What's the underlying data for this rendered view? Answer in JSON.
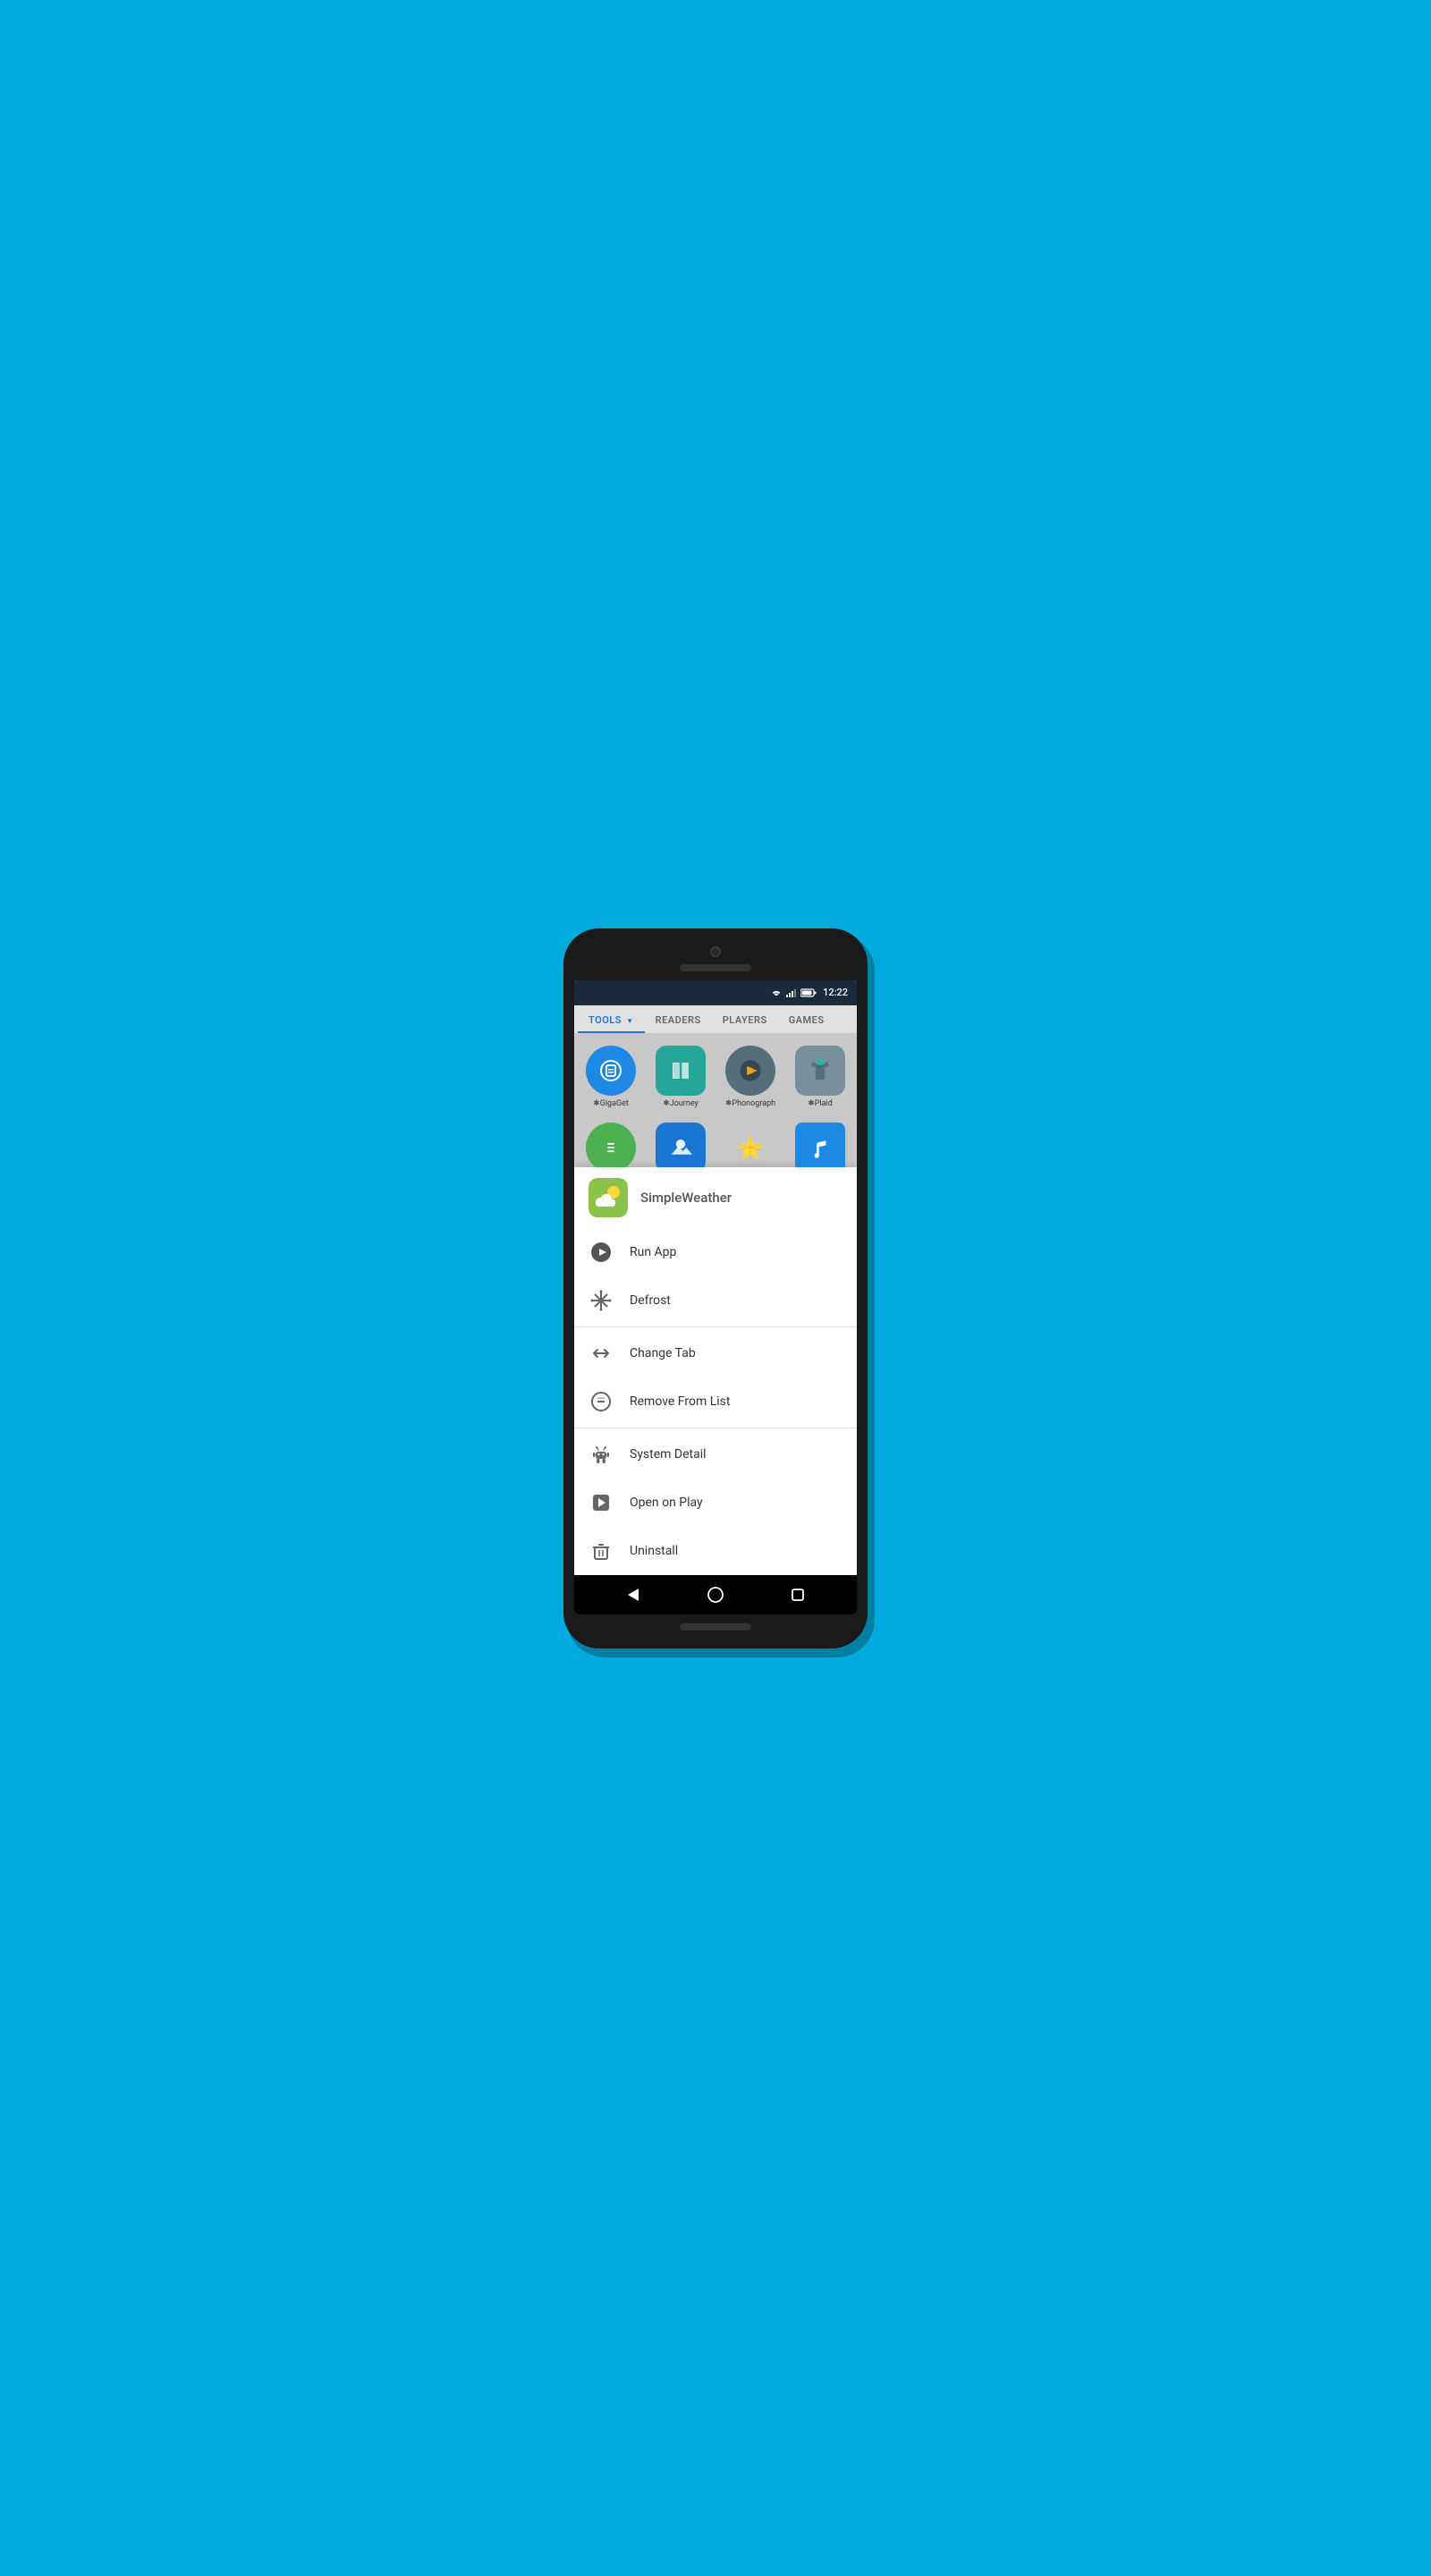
{
  "statusBar": {
    "time": "12:22"
  },
  "tabs": [
    {
      "label": "TOOLS",
      "active": true,
      "dropdown": true
    },
    {
      "label": "READERS",
      "active": false
    },
    {
      "label": "PLAYERS",
      "active": false
    },
    {
      "label": "GAMES",
      "active": false
    }
  ],
  "appGrid": {
    "row1": [
      {
        "name": "GigaGet",
        "icon": "gigaget"
      },
      {
        "name": "Journey",
        "icon": "journey"
      },
      {
        "name": "Phonograph",
        "icon": "phonograph"
      },
      {
        "name": "Plaid",
        "icon": "plaid"
      }
    ],
    "row2": [
      {
        "name": "",
        "icon": "row2-1"
      },
      {
        "name": "",
        "icon": "row2-2"
      },
      {
        "name": "",
        "icon": "row2-3"
      },
      {
        "name": "",
        "icon": "row2-4"
      }
    ]
  },
  "contextMenu": {
    "appName": "SimpleWeather",
    "appIcon": "simpleweather",
    "items": [
      {
        "id": "run-app",
        "label": "Run App",
        "icon": "play"
      },
      {
        "id": "defrost",
        "label": "Defrost",
        "icon": "snowflake"
      },
      {
        "divider": true
      },
      {
        "id": "change-tab",
        "label": "Change Tab",
        "icon": "change-tab"
      },
      {
        "id": "remove-from-list",
        "label": "Remove From List",
        "icon": "remove"
      },
      {
        "divider": true
      },
      {
        "id": "system-detail",
        "label": "System Detail",
        "icon": "android"
      },
      {
        "id": "open-on-play",
        "label": "Open on Play",
        "icon": "play-store"
      },
      {
        "id": "uninstall",
        "label": "Uninstall",
        "icon": "trash"
      }
    ]
  },
  "navBar": {
    "back": "◁",
    "home": "○",
    "recents": "□"
  }
}
